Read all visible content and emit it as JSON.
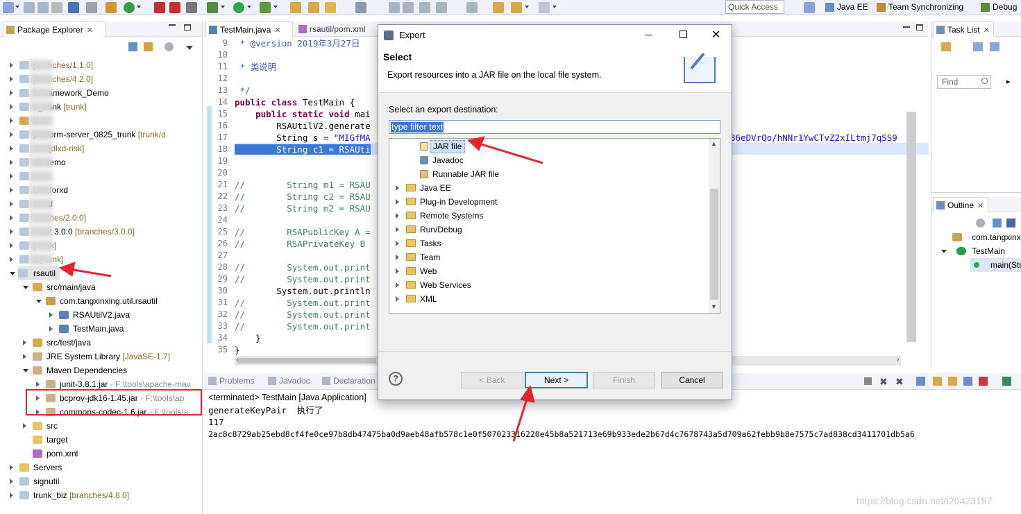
{
  "toolbar": {
    "quick_access": "Quick Access",
    "perspectives": [
      "Java EE",
      "Team Synchronizing",
      "Debug"
    ]
  },
  "package_explorer": {
    "tab": "Package Explorer",
    "items": [
      {
        "name": "",
        "suffix": "[branches/1.1.0]"
      },
      {
        "name": "",
        "suffix": "[branches/4.2.0]"
      },
      {
        "name": "toFramework_Demo",
        "suffix": ""
      },
      {
        "name": "o_trunk",
        "suffix": "[trunk]"
      },
      {
        "name": "Util",
        "suffix": ""
      },
      {
        "name": "platform-server_0825_trunk",
        "suffix": "[trunk/d"
      },
      {
        "name": "risk",
        "suffix": "[dlxd-risk]"
      },
      {
        "name": "dk-demo",
        "suffix": ""
      },
      {
        "name": "",
        "suffix": ""
      },
      {
        "name": "Utilsforxd",
        "suffix": ""
      },
      {
        "name": "utilxd",
        "suffix": ""
      },
      {
        "name": "",
        "suffix": "ranches/2.0.0]"
      },
      {
        "name": "ment 3.0.0",
        "suffix": "[branches/3.0.0]"
      },
      {
        "name": "",
        "suffix": "[trunk]"
      },
      {
        "name": "e",
        "suffix": "[trunk]"
      },
      {
        "name": "rsautil",
        "suffix": ""
      },
      {
        "name": "src/main/java",
        "suffix": ""
      },
      {
        "name": "com.tangxinxing.util.rsautil",
        "suffix": ""
      },
      {
        "name": "RSAUtilV2.java",
        "suffix": ""
      },
      {
        "name": "TestMain.java",
        "suffix": ""
      },
      {
        "name": "src/test/java",
        "suffix": ""
      },
      {
        "name": "JRE System Library",
        "suffix": "[JavaSE-1.7]"
      },
      {
        "name": "Maven Dependencies",
        "suffix": ""
      },
      {
        "name": "junit-3.8.1.jar",
        "suffix": "- F:\\tools\\apache-mav"
      },
      {
        "name": "bcprov-jdk16-1.45.jar",
        "suffix": "- F:\\tools\\ap"
      },
      {
        "name": "commons-codec-1.6.jar",
        "suffix": "- F:\\tools\\a"
      },
      {
        "name": "src",
        "suffix": ""
      },
      {
        "name": "target",
        "suffix": ""
      },
      {
        "name": "pom.xml",
        "suffix": ""
      },
      {
        "name": "Servers",
        "suffix": ""
      },
      {
        "name": "signutil",
        "suffix": ""
      },
      {
        "name": "trunk_biz",
        "suffix": "[branches/4.8.0]"
      }
    ]
  },
  "editor": {
    "tabs": [
      "TestMain.java",
      "rsautil/pom.xml"
    ],
    "line_numbers": [
      "9",
      "10",
      "11",
      "12",
      "13",
      "14",
      "15",
      "16",
      "17",
      "18",
      "19",
      "20",
      "21",
      "22",
      "23",
      "24",
      "25",
      "26",
      "27",
      "28",
      "29",
      "30",
      "31",
      "32",
      "33",
      "34",
      "35"
    ],
    "lines": [
      " * @version 2019年3月27日 ",
      "",
      " * 类说明",
      "",
      " */",
      "public class TestMain {",
      "    public static void mai",
      "        RSAUtilV2.generate",
      "        String s = \"MIGfMA",
      "        String c1 = RSAUti",
      "",
      "",
      "//        String m1 = RSAU",
      "//        String c2 = RSAU",
      "//        String m2 = RSAU",
      "",
      "//        RSAPublicKey A =",
      "//        RSAPrivateKey B ",
      "",
      "//        System.out.print",
      "//        System.out.print",
      "        System.out.println",
      "//        System.out.print",
      "//        System.out.print",
      "//        System.out.print",
      "    }",
      "}"
    ],
    "line17_tail": "36eDVrQo/hNNr1YwCTvZ2xILtmj7qSS9"
  },
  "console": {
    "tabs": [
      "Problems",
      "Javadoc",
      "Declaration"
    ],
    "header": "<terminated> TestMain [Java Application]",
    "output": [
      "generateKeyPair  执行了",
      "117",
      "2ac8c8729ab25ebd8cf4fe0ce97b8db47475ba0d9aeb48afb578c1e0f507023316220e45b8a521713e69b933ede2b67d4c7678743a5d709a62febb9b8e7575c7ad838cd3411701db5a6"
    ]
  },
  "task_list": {
    "tab": "Task List",
    "find_placeholder": "Find"
  },
  "outline": {
    "tab": "Outline",
    "items": [
      "com.tangxinx",
      "TestMain",
      "main(Str"
    ]
  },
  "dialog": {
    "title": "Export",
    "heading": "Select",
    "description": "Export resources into a JAR file on the local file system.",
    "destination_label": "Select an export destination:",
    "filter_value": "type filter text",
    "tree": [
      {
        "label": "JAR file",
        "kind": "item",
        "selected": true
      },
      {
        "label": "Javadoc",
        "kind": "item"
      },
      {
        "label": "Runnable JAR file",
        "kind": "item"
      },
      {
        "label": "Java EE",
        "kind": "folder"
      },
      {
        "label": "Plug-in Development",
        "kind": "folder"
      },
      {
        "label": "Remote Systems",
        "kind": "folder"
      },
      {
        "label": "Run/Debug",
        "kind": "folder"
      },
      {
        "label": "Tasks",
        "kind": "folder"
      },
      {
        "label": "Team",
        "kind": "folder"
      },
      {
        "label": "Web",
        "kind": "folder"
      },
      {
        "label": "Web Services",
        "kind": "folder"
      },
      {
        "label": "XML",
        "kind": "folder"
      }
    ],
    "buttons": {
      "back": "< Back",
      "next": "Next >",
      "finish": "Finish",
      "cancel": "Cancel"
    },
    "help": "?"
  },
  "watermark": "https://blog.csdn.net/t20423187"
}
